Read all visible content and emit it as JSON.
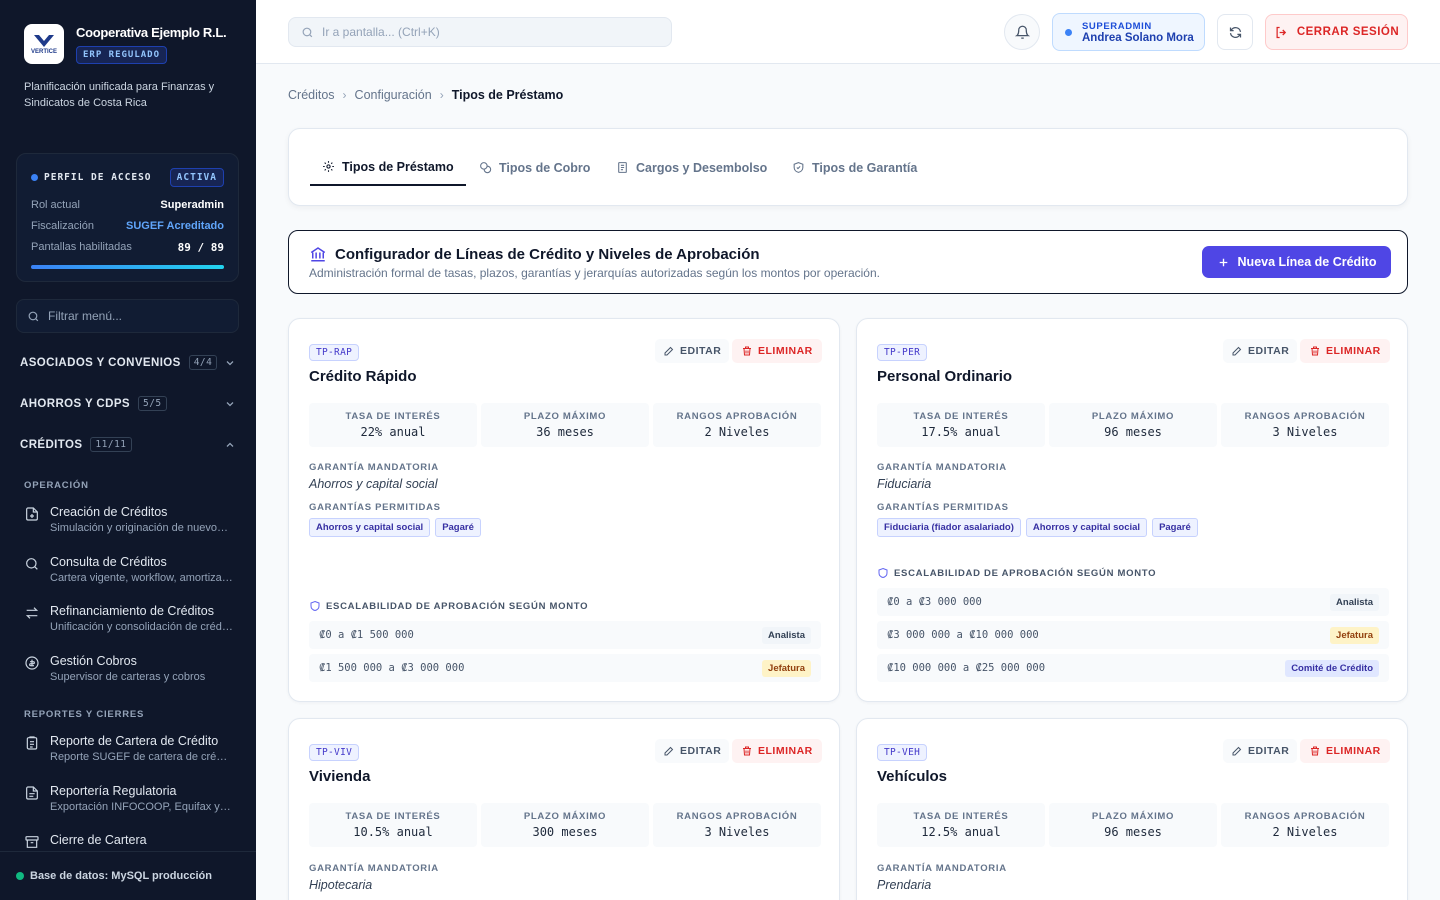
{
  "sidebar": {
    "logo_text": "VERTICE",
    "org_name": "Cooperativa Ejemplo R.L.",
    "erp_badge": "ERP REGULADO",
    "tagline": "Planificación unificada para Finanzas y Sindicatos de Costa Rica",
    "profile": {
      "title": "PERFIL DE ACCESO",
      "status": "ACTIVA",
      "rol_label": "Rol actual",
      "rol_value": "Superadmin",
      "fisc_label": "Fiscalización",
      "fisc_value": "SUGEF Acreditado",
      "pantallas_label": "Pantallas habilitadas",
      "pantallas_value": "89 / 89",
      "pantallas_fraction": 1.0
    },
    "filter_placeholder": "Filtrar menú...",
    "groups": [
      {
        "label": "ASOCIADOS Y CONVENIOS",
        "count": "4/4"
      },
      {
        "label": "AHORROS Y CDPS",
        "count": "5/5"
      },
      {
        "label": "CRÉDITOS",
        "count": "11/11"
      }
    ],
    "sections": {
      "operacion": "OPERACIÓN",
      "reportes": "REPORTES Y CIERRES"
    },
    "items": [
      {
        "title": "Creación de Créditos",
        "sub": "Simulación y originación de nuevos créditos"
      },
      {
        "title": "Consulta de Créditos",
        "sub": "Cartera vigente, workflow, amortización"
      },
      {
        "title": "Refinanciamiento de Créditos",
        "sub": "Unificación y consolidación de créditos"
      },
      {
        "title": "Gestión Cobros",
        "sub": "Supervisor de carteras y cobros"
      },
      {
        "title": "Reporte de Cartera de Crédito",
        "sub": "Reporte SUGEF de cartera de crédito"
      },
      {
        "title": "Reportería Regulatoria",
        "sub": "Exportación INFOCOOP, Equifax y otros"
      },
      {
        "title": "Cierre de Cartera",
        "sub": ""
      }
    ],
    "footer": "Base de datos: MySQL producción"
  },
  "topbar": {
    "search_placeholder": "Ir a pantalla... (Ctrl+K)",
    "user_role": "SUPERADMIN",
    "user_name": "Andrea Solano Mora",
    "logout_label": "CERRAR SESIÓN"
  },
  "breadcrumb": [
    "Créditos",
    "Configuración",
    "Tipos de Préstamo"
  ],
  "tabs": [
    "Tipos de Préstamo",
    "Tipos de Cobro",
    "Cargos y Desembolso",
    "Tipos de Garantía"
  ],
  "config": {
    "title": "Configurador de Líneas de Crédito y Niveles de Aprobación",
    "subtitle": "Administración formal de tasas, plazos, garantías y jerarquías autorizadas según los montos por operación.",
    "new_button": "Nueva Línea de Crédito"
  },
  "labels": {
    "edit": "EDITAR",
    "delete": "ELIMINAR",
    "tasa": "TASA DE INTERÉS",
    "plazo": "PLAZO MÁXIMO",
    "rangos": "RANGOS APROBACIÓN",
    "garantia_mandatoria": "GARANTÍA MANDATORIA",
    "garantias_permitidas": "GARANTÍAS PERMITIDAS",
    "escalabilidad": "ESCALABILIDAD DE APROBACIÓN SEGÚN MONTO"
  },
  "loans": [
    {
      "code": "TP-RAP",
      "name": "Crédito Rápido",
      "tasa": "22% anual",
      "plazo": "36 meses",
      "rangos": "2 Niveles",
      "mandatoria": "Ahorros y capital social",
      "permitidas": [
        "Ahorros y capital social",
        "Pagaré"
      ],
      "ranges": [
        {
          "range": "₡0 a ₡1 500 000",
          "level": "Analista",
          "tone": "slate"
        },
        {
          "range": "₡1 500 000 a ₡3 000 000",
          "level": "Jefatura",
          "tone": "amber"
        }
      ]
    },
    {
      "code": "TP-PER",
      "name": "Personal Ordinario",
      "tasa": "17.5% anual",
      "plazo": "96 meses",
      "rangos": "3 Niveles",
      "mandatoria": "Fiduciaria",
      "permitidas": [
        "Fiduciaria (fiador asalariado)",
        "Ahorros y capital social",
        "Pagaré"
      ],
      "ranges": [
        {
          "range": "₡0 a ₡3 000 000",
          "level": "Analista",
          "tone": "slate"
        },
        {
          "range": "₡3 000 000 a ₡10 000 000",
          "level": "Jefatura",
          "tone": "amber"
        },
        {
          "range": "₡10 000 000 a ₡25 000 000",
          "level": "Comité de Crédito",
          "tone": "indigo"
        }
      ]
    },
    {
      "code": "TP-VIV",
      "name": "Vivienda",
      "tasa": "10.5% anual",
      "plazo": "300 meses",
      "rangos": "3 Niveles",
      "mandatoria": "Hipotecaria"
    },
    {
      "code": "TP-VEH",
      "name": "Vehículos",
      "tasa": "12.5% anual",
      "plazo": "96 meses",
      "rangos": "2 Niveles",
      "mandatoria": "Prendaria"
    }
  ]
}
